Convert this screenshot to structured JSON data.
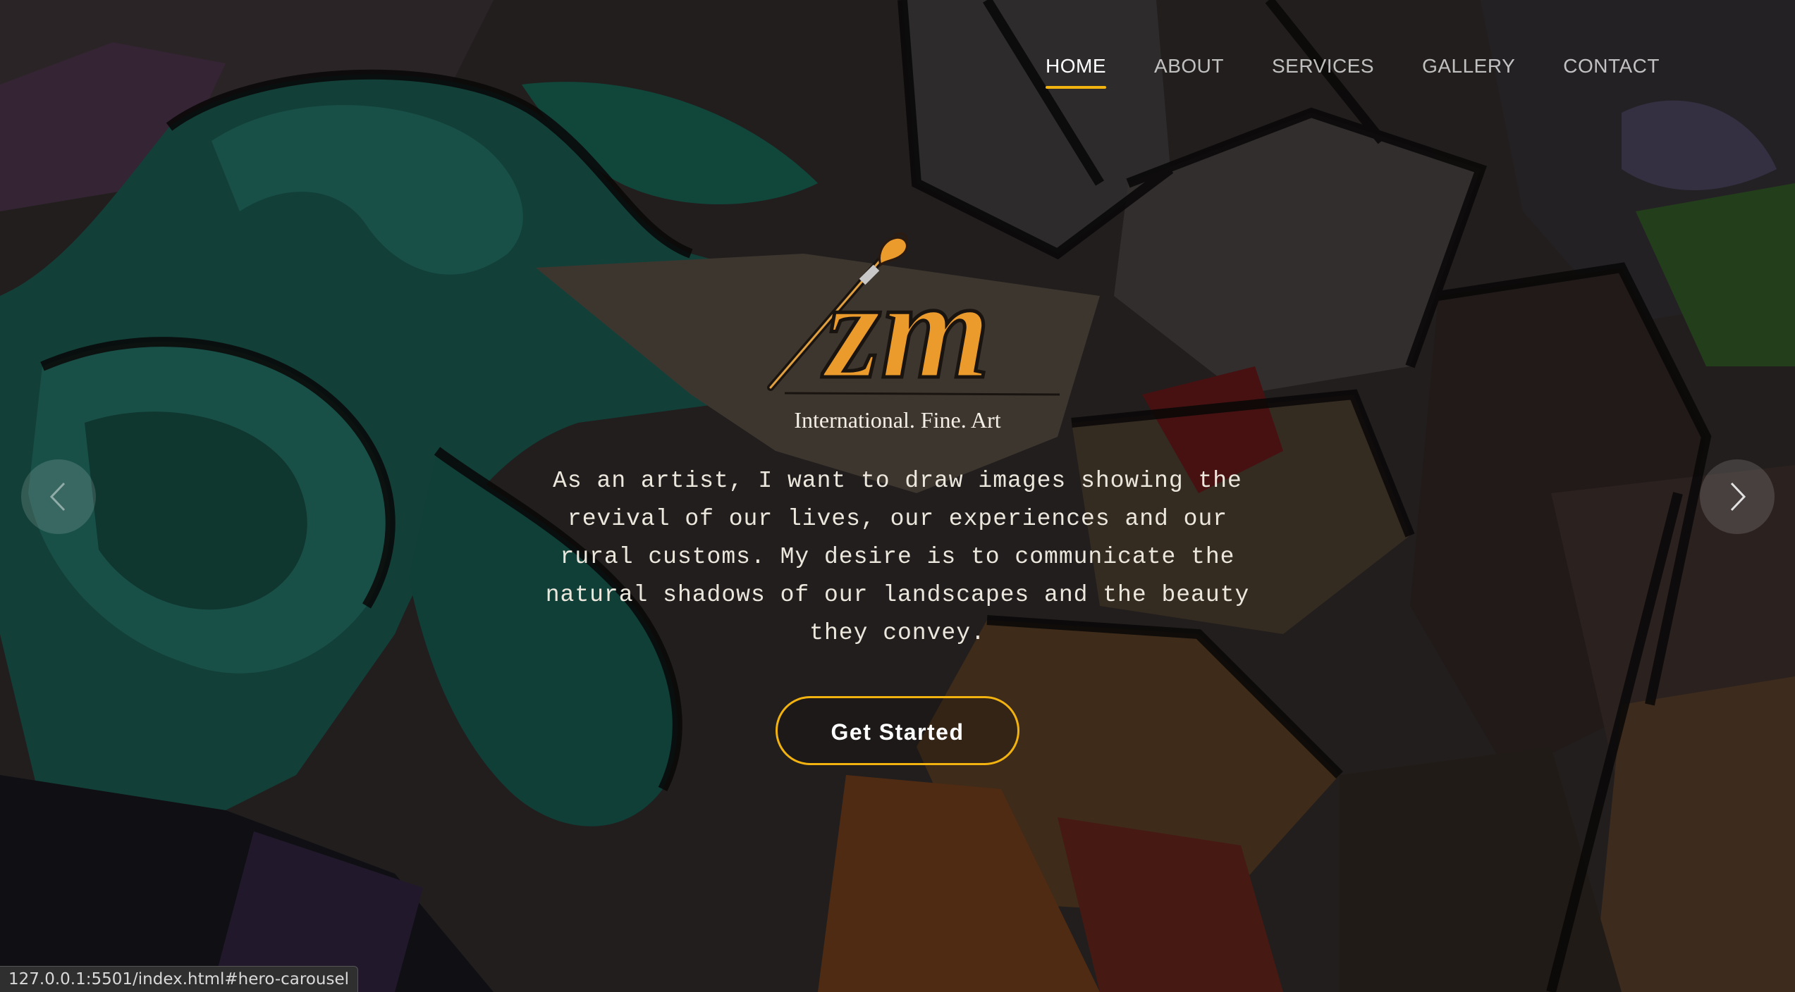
{
  "nav": {
    "items": [
      {
        "label": "HOME",
        "active": true
      },
      {
        "label": "ABOUT",
        "active": false
      },
      {
        "label": "SERVICES",
        "active": false
      },
      {
        "label": "GALLERY",
        "active": false
      },
      {
        "label": "CONTACT",
        "active": false
      }
    ]
  },
  "hero": {
    "logo_mark": "zm",
    "logo_tagline": "International. Fine. Art",
    "intro_text": "As an artist, I want to draw images showing the revival of our lives, our experiences and our rural customs. My desire is to communicate the natural shadows of our landscapes and the beauty they convey.",
    "cta_label": "Get Started",
    "prev_icon": "chevron-left-icon",
    "next_icon": "chevron-right-icon"
  },
  "status_bar": {
    "url": "127.0.0.1:5501/index.html#hero-carousel"
  },
  "colors": {
    "accent": "#f2b311",
    "logo_orange": "#eb9a2c"
  }
}
